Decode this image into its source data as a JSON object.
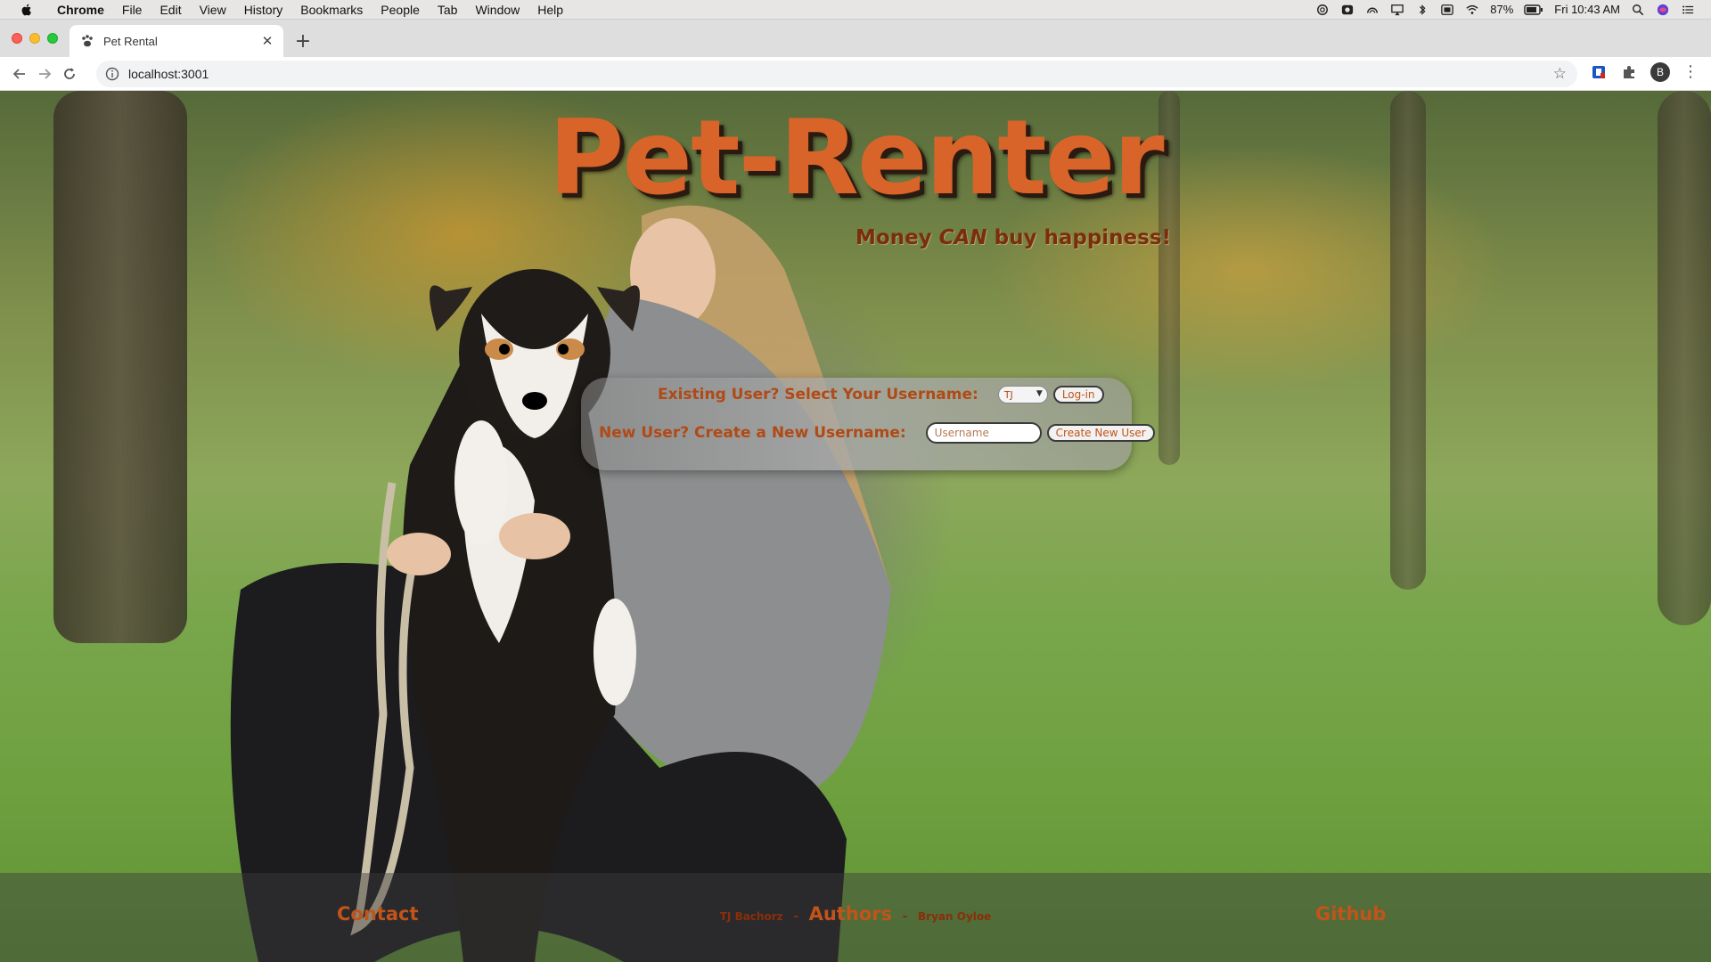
{
  "menubar": {
    "app_name": "Chrome",
    "items": [
      "File",
      "Edit",
      "View",
      "History",
      "Bookmarks",
      "People",
      "Tab",
      "Window",
      "Help"
    ],
    "battery": "87%",
    "clock": "Fri 10:43 AM"
  },
  "browser": {
    "tab_title": "Pet Rental",
    "new_tab_symbol": "+",
    "url": "localhost:3001",
    "profile_initial": "B"
  },
  "page": {
    "title": "Pet-Renter",
    "tagline_pre": "Money",
    "tagline_em": "CAN",
    "tagline_post": "buy happiness!",
    "existing_label": "Existing User? Select Your Username:",
    "selected_username": "TJ",
    "login_button": "Log-in",
    "new_label": "New User? Create a New Username:",
    "username_placeholder": "Username",
    "username_value": "",
    "create_button": "Create New User"
  },
  "footer": {
    "contact": "Contact",
    "author_left": "TJ Bachorz",
    "author_sep": "-",
    "authors": "Authors",
    "author_right": "Bryan Oyloe",
    "github": "Github"
  },
  "colors": {
    "brand_orange": "#d9642a",
    "label_orange": "#b04a16"
  }
}
